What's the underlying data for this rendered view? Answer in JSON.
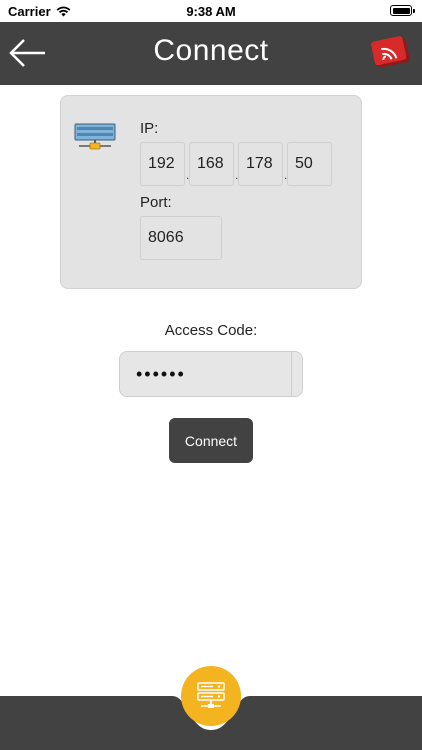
{
  "status_bar": {
    "carrier": "Carrier",
    "time": "9:38 AM"
  },
  "header": {
    "title": "Connect",
    "back_icon": "arrow-left-icon",
    "brand_icon": "cast-logo-icon"
  },
  "server": {
    "icon": "server-network-icon",
    "ip_label": "IP:",
    "ip_octets": [
      "192",
      "168",
      "178",
      "50"
    ],
    "separator": ".",
    "port_label": "Port:",
    "port": "8066"
  },
  "access": {
    "label": "Access Code:",
    "masked_value": "••••••"
  },
  "connect_button": {
    "label": "Connect"
  },
  "bottom_nav": {
    "icon": "server-rack-icon"
  },
  "colors": {
    "header_bg": "#424242",
    "card_bg": "#e3e3e3",
    "accent": "#f4b41f",
    "brand_red": "#d92a2a"
  }
}
